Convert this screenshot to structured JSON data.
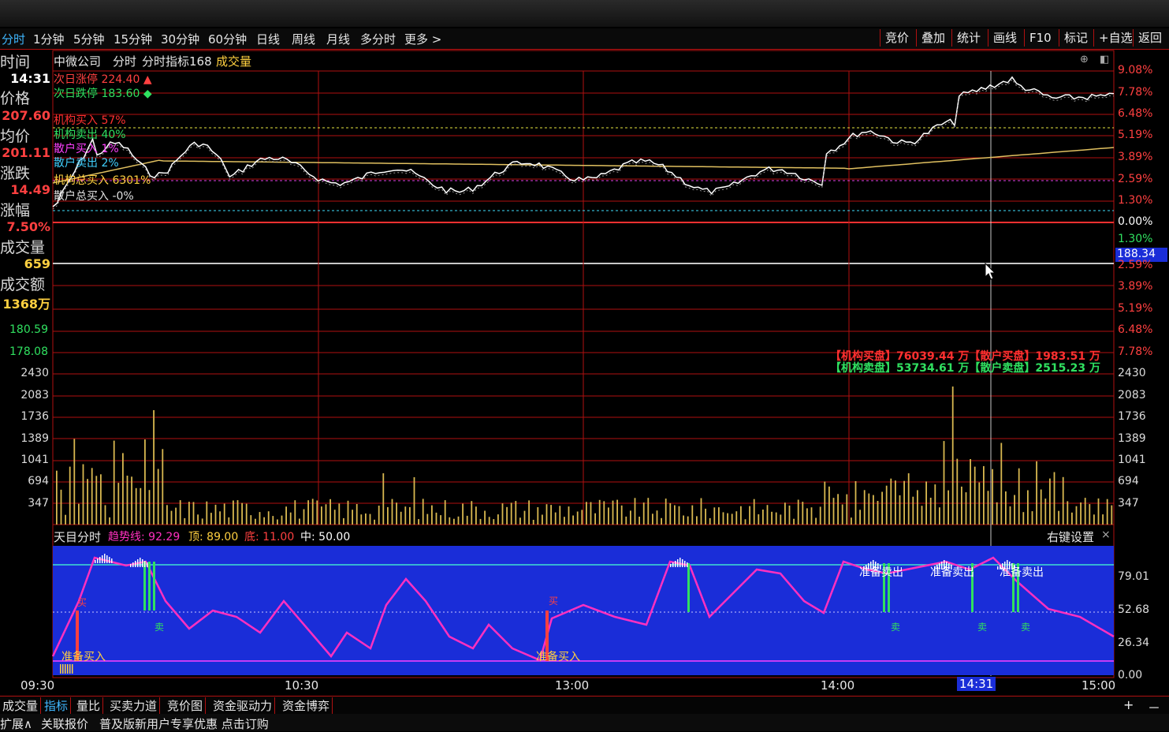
{
  "period_tabs": [
    "分时",
    "1分钟",
    "5分钟",
    "15分钟",
    "30分钟",
    "60分钟",
    "日线",
    "周线",
    "月线",
    "多分时",
    "更多 >"
  ],
  "right_buttons": [
    "竞价",
    "叠加",
    "统计",
    "画线",
    "F10",
    "标记",
    "+自选",
    "返回"
  ],
  "left_panel": {
    "time_label": "时间",
    "time_value": "14:31",
    "price_label": "价格",
    "price_value": "207.60",
    "avg_label": "均价",
    "avg_value": "201.11",
    "change_label": "涨跌",
    "change_value": "14.49",
    "pct_label": "涨幅",
    "pct_value": "7.50%",
    "vol_label": "成交量",
    "vol_value": "659",
    "amount_label": "成交额",
    "amount_value": "1368万"
  },
  "chart_header": {
    "stock": "中微公司",
    "mode": "分时",
    "indicator": "分时指标168",
    "volume": "成交量"
  },
  "overlay_labels": [
    {
      "text": "次日涨停 224.40 ▲",
      "color": "#ff4040"
    },
    {
      "text": "次日跌停 183.60 ◆",
      "color": "#30e060"
    },
    {
      "text": "机构买入 57%",
      "color": "#ff3030"
    },
    {
      "text": "机构卖出 40%",
      "color": "#30e060"
    },
    {
      "text": "散户买入 1%",
      "color": "#ff40ff"
    },
    {
      "text": "散户卖出 2%",
      "color": "#40d0ff"
    },
    {
      "text": "机构总买入 6301%",
      "color": "#ffd040"
    },
    {
      "text": "散户总买入 -0%",
      "color": "#e0e0e0"
    }
  ],
  "price_axis_right": [
    "9.08%",
    "7.78%",
    "6.48%",
    "5.19%",
    "3.89%",
    "2.59%",
    "1.30%",
    "0.00%",
    "1.30%"
  ],
  "price_marker": "188.34",
  "mid_axis_right": [
    "2.59%",
    "3.89%",
    "5.19%",
    "6.48%",
    "7.78%"
  ],
  "mid_axis_left": [
    "180.59",
    "178.08"
  ],
  "volume_axis": [
    "2430",
    "2083",
    "1736",
    "1389",
    "1041",
    "694",
    "347"
  ],
  "flow_text": {
    "line1": "【机构买盘】76039.44 万【散户买盘】1983.51 万",
    "line2": "【机构卖盘】53734.61 万【散户卖盘】2515.23 万"
  },
  "indicator_header": {
    "name": "天目分时",
    "trend": "趋势线: 92.29",
    "top": "顶: 89.00",
    "bottom": "底: 11.00",
    "mid": "中: 50.00",
    "settings": "右键设置",
    "close": "×"
  },
  "indicator_axis": [
    "79.01",
    "52.68",
    "26.34",
    "0.00"
  ],
  "signal_labels": {
    "buy_prepare": "准备买入",
    "sell_prepare": "准备卖出",
    "buy": "买",
    "sell": "卖"
  },
  "time_axis": [
    "09:30",
    "10:30",
    "13:00",
    "14:00",
    "14:31",
    "15:00"
  ],
  "bottom_tabs": [
    "成交量",
    "指标",
    "量比",
    "买卖力道",
    "竞价图",
    "资金驱动力",
    "资金博弈"
  ],
  "bottom_right": [
    "+",
    "－"
  ],
  "status_bar": {
    "expand": "扩展∧",
    "related": "关联报价",
    "promo": "普及版新用户专享优惠 点击订购"
  },
  "colors": {
    "grid": "#b01010",
    "price_line": "#ffffff",
    "avg_line": "#e0c060",
    "indicator_bg": "#1a2dd8",
    "trend": "#ff30c0",
    "up": "#ff3030",
    "down": "#30e060",
    "accent": "#3fb7ff"
  }
}
